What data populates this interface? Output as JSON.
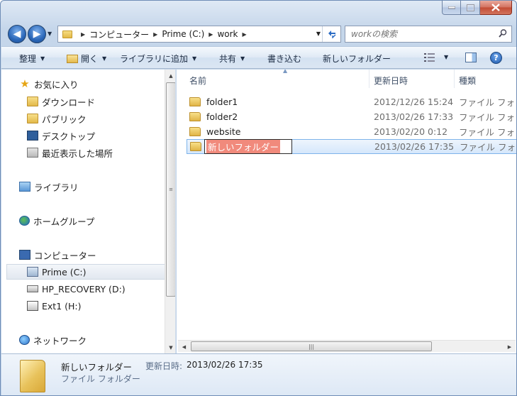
{
  "window": {
    "caption_buttons": {
      "minimize": "▁",
      "maximize": "□",
      "close": "✕"
    }
  },
  "nav": {
    "back_glyph": "◀",
    "forward_glyph": "▶",
    "breadcrumbs": [
      "コンピューター",
      "Prime (C:)",
      "work"
    ],
    "search_placeholder": "workの検索"
  },
  "toolbar": {
    "organize": "整理",
    "open": "開く",
    "add_to_library": "ライブラリに追加",
    "share": "共有",
    "burn": "書き込む",
    "new_folder": "新しいフォルダー",
    "help": "?"
  },
  "sidebar": {
    "favorites": "お気に入り",
    "downloads": "ダウンロード",
    "public": "パブリック",
    "desktop": "デスクトップ",
    "recent": "最近表示した場所",
    "libraries": "ライブラリ",
    "homegroup": "ホームグループ",
    "computer": "コンピューター",
    "drive_c": "Prime (C:)",
    "drive_d": "HP_RECOVERY (D:)",
    "drive_h": "Ext1 (H:)",
    "network": "ネットワーク"
  },
  "columns": {
    "name": "名前",
    "date": "更新日時",
    "type": "種類"
  },
  "files": [
    {
      "name": "folder1",
      "date": "2012/12/26 15:24",
      "type": "ファイル フォ"
    },
    {
      "name": "folder2",
      "date": "2013/02/26 17:33",
      "type": "ファイル フォ"
    },
    {
      "name": "website",
      "date": "2013/02/20 0:12",
      "type": "ファイル フォ"
    },
    {
      "name": "新しいフォルダー",
      "date": "2013/02/26 17:35",
      "type": "ファイル フォ"
    }
  ],
  "details": {
    "name": "新しいフォルダー",
    "date_label": "更新日時:",
    "date": "2013/02/26 17:35",
    "type": "ファイル フォルダー"
  },
  "colors": {
    "selection": "#d5e7fb",
    "rename_highlight": "#f18a7c",
    "accent": "#2a67b9"
  }
}
